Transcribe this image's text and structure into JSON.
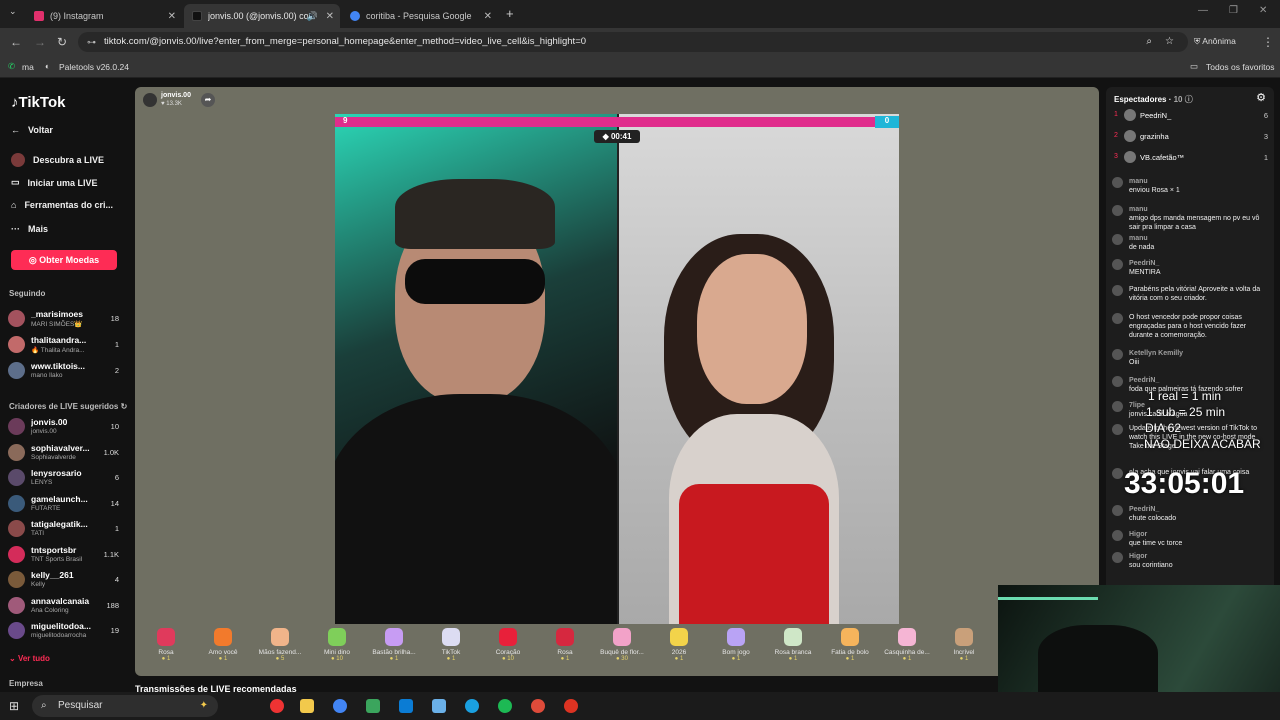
{
  "browser": {
    "tabs": [
      {
        "label": "(9) Instagram",
        "color": "#e1306c"
      },
      {
        "label": "jonvis.00 (@jonvis.00) com",
        "color": "#111111"
      },
      {
        "label": "coritiba - Pesquisa Google",
        "color": "#4285f4"
      }
    ],
    "url": "tiktok.com/@jonvis.00/live?enter_from_merge=personal_homepage&enter_method=video_live_cell&is_highlight=0",
    "profile": "Anônima",
    "bookmarks": [
      "ma",
      "Paletools v26.0.24"
    ],
    "all_bookmarks": "Todos os favoritos"
  },
  "sidebar": {
    "logo": "TikTok",
    "back": "Voltar",
    "nav": [
      "Descubra a LIVE",
      "Iniciar uma LIVE",
      "Ferramentas do cri...",
      "Mais"
    ],
    "coins_button": "Obter Moedas",
    "following_title": "Seguindo",
    "following": [
      {
        "name": "_marisimoes",
        "sub": "MARI SIMÕES👑",
        "count": "18"
      },
      {
        "name": "thalitaandra...",
        "sub": "🔥 Thalita Andra...",
        "count": "1"
      },
      {
        "name": "www.tiktois...",
        "sub": "mano llako",
        "count": "2"
      }
    ],
    "suggested_title": "Criadores de LIVE sugeridos",
    "suggested": [
      {
        "name": "jonvis.00",
        "sub": "jonvis.00",
        "count": "10"
      },
      {
        "name": "sophiavalver...",
        "sub": "Sophiavalverde",
        "count": "1.0K"
      },
      {
        "name": "lenysrosario",
        "sub": "LENYS",
        "count": "6"
      },
      {
        "name": "gamelaunch...",
        "sub": "FUTARTE",
        "count": "14"
      },
      {
        "name": "tatigalegatik...",
        "sub": "TATI",
        "count": "1"
      },
      {
        "name": "tntsportsbr",
        "sub": "TNT Sports Brasil",
        "count": "1.1K"
      },
      {
        "name": "kelly__261",
        "sub": "Kelly",
        "count": "4"
      },
      {
        "name": "annavalcanaia",
        "sub": "Ana Coloring",
        "count": "188"
      },
      {
        "name": "miguelitodoa...",
        "sub": "miguelitodoarrocha",
        "count": "19"
      }
    ],
    "see_all": "Ver tudo",
    "company": "Empresa"
  },
  "stream": {
    "host": "jonvis.00",
    "host_likes": "13.3K",
    "pk_left_score": "9",
    "pk_right_score": "0",
    "timer": "00:41",
    "recommended": "Transmissões de LIVE recomendadas",
    "gifts": [
      {
        "name": "Rosa",
        "price": "1",
        "color": "#e03a5c"
      },
      {
        "name": "Amo você",
        "price": "1",
        "color": "#f27a2c"
      },
      {
        "name": "Mãos fazend...",
        "price": "5",
        "color": "#f0b48a"
      },
      {
        "name": "Mini dino",
        "price": "10",
        "color": "#7fcf5a"
      },
      {
        "name": "Bastão brilha...",
        "price": "1",
        "color": "#c79cf3"
      },
      {
        "name": "TikTok",
        "price": "1",
        "color": "#dcdcf2"
      },
      {
        "name": "Coração",
        "price": "10",
        "color": "#e8203a"
      },
      {
        "name": "Rosa",
        "price": "1",
        "color": "#d6283f"
      },
      {
        "name": "Buquê de flor...",
        "price": "30",
        "color": "#f2a2c8"
      },
      {
        "name": "2026",
        "price": "1",
        "color": "#f2d34a"
      },
      {
        "name": "Bom jogo",
        "price": "1",
        "color": "#b9a3f5"
      },
      {
        "name": "Rosa branca",
        "price": "1",
        "color": "#cfe7c7"
      },
      {
        "name": "Fatia de bolo",
        "price": "1",
        "color": "#f6b45c"
      },
      {
        "name": "Casquinha de...",
        "price": "1",
        "color": "#f5b5d4"
      },
      {
        "name": "Incrível",
        "price": "1",
        "color": "#c9a07a"
      }
    ]
  },
  "viewers": {
    "title": "Espectadores",
    "count": "10",
    "top": [
      {
        "rank": "1",
        "name": "PeedriN_",
        "score": "6"
      },
      {
        "rank": "2",
        "name": "grazinha",
        "score": "3"
      },
      {
        "rank": "3",
        "name": "VB.cafetão™",
        "score": "1"
      }
    ]
  },
  "chat": [
    {
      "user": "manu",
      "text": "enviou Rosa × 1"
    },
    {
      "user": "manu",
      "text": "amigo dps manda mensagem no pv eu vô sair pra limpar a casa"
    },
    {
      "user": "manu",
      "text": "de nada"
    },
    {
      "user": "PeedriN_",
      "text": "MENTIRA"
    },
    {
      "user": "",
      "text": "Parabéns pela vitória! Aproveite a volta da vitória com o seu criador."
    },
    {
      "user": "",
      "text": "O host vencedor pode propor coisas engraçadas para o host vencido fazer durante a comemoração."
    },
    {
      "user": "Ketellyn Kemilly",
      "text": "Oiii"
    },
    {
      "user": "PeedriN_",
      "text": "foda que palmeiras tá fazendo sofrer"
    },
    {
      "user": "7lipe",
      "text": "jonvis cadê a água"
    },
    {
      "user": "",
      "text": "Update to the newest version of TikTok to watch this LIVE in the new co-host mode Take the Stage."
    },
    {
      "user": "",
      "text": "ela acha que jonvis vai falar uma coisa"
    },
    {
      "user": "PeedriN_",
      "text": "chute colocado"
    },
    {
      "user": "Higor",
      "text": "que time vc torce"
    },
    {
      "user": "Higor",
      "text": "sou corintiano"
    }
  ],
  "overlay": {
    "line1": "1 real = 1 min",
    "line2": "1 sub = 25 min",
    "line3": "DIA 62",
    "line4": "NAO DEIXA ACABAR",
    "timer": "33:05:01"
  },
  "taskbar": {
    "search": "Pesquisar"
  }
}
